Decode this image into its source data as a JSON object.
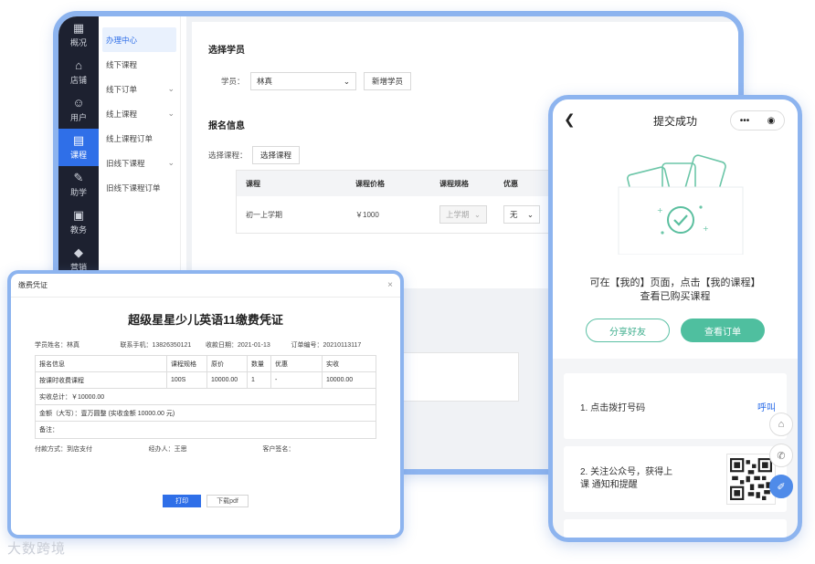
{
  "tablet": {
    "rail": [
      {
        "icon": "dashboard-icon",
        "glyph": "▦",
        "label": "概况"
      },
      {
        "icon": "store-icon",
        "glyph": "⌂",
        "label": "店铺"
      },
      {
        "icon": "user-icon",
        "glyph": "☺",
        "label": "用户"
      },
      {
        "icon": "course-icon",
        "glyph": "▤",
        "label": "课程"
      },
      {
        "icon": "tutor-icon",
        "glyph": "✎",
        "label": "助学"
      },
      {
        "icon": "teaching-icon",
        "glyph": "▣",
        "label": "教务"
      },
      {
        "icon": "marketing-icon",
        "glyph": "◆",
        "label": "营销"
      }
    ],
    "submenu": [
      {
        "label": "办理中心",
        "expandable": false
      },
      {
        "label": "线下课程",
        "expandable": false
      },
      {
        "label": "线下订单",
        "expandable": true
      },
      {
        "label": "线上课程",
        "expandable": true
      },
      {
        "label": "线上课程订单",
        "expandable": false
      },
      {
        "label": "旧线下课程",
        "expandable": true
      },
      {
        "label": "旧线下课程订单",
        "expandable": false
      }
    ],
    "select_student": {
      "title": "选择学员",
      "label": "学员：",
      "value": "林真",
      "add_button": "新增学员"
    },
    "signup": {
      "title": "报名信息",
      "label": "选择课程：",
      "choose_button": "选择课程",
      "headers": [
        "课程",
        "课程价格",
        "课程规格",
        "优惠"
      ],
      "row": {
        "course": "初一上学期",
        "price": "￥1000",
        "spec": "上学期",
        "discount": "无"
      }
    }
  },
  "receipt": {
    "window_title": "缴费凭证",
    "title": "超级星星少儿英语11缴费凭证",
    "meta": [
      "学员姓名：林真",
      "联系手机：13826350121",
      "收款日期：2021-01-13",
      "订单编号：20210113117"
    ],
    "headers": [
      "报名信息",
      "课程规格",
      "原价",
      "数量",
      "优惠",
      "实收"
    ],
    "row": [
      "按课时收费课程",
      "100S",
      "10000.00",
      "1",
      "-",
      "10000.00"
    ],
    "total": "实收总计：￥10000.00",
    "amount_words": "金额（大写）：壹万圆整 (实收金额 10000.00 元)",
    "remark": "备注：",
    "footer": [
      "付款方式：到店支付",
      "经办人：王思",
      "客户签名："
    ],
    "print_button": "打印",
    "download_button": "下载pdf"
  },
  "phone": {
    "title": "提交成功",
    "message_line1": "可在【我的】页面，点击【我的课程】",
    "message_line2": "查看已购买课程",
    "share_button": "分享好友",
    "view_order_button": "查看订单",
    "step1": "1. 点击拨打号码",
    "call_link": "呼叫",
    "step2_line1": "2. 关注公众号，获得上",
    "step2_line2": "课 通知和提醒"
  },
  "watermark": "大数跨境",
  "colors": {
    "primary": "#2f6fe8",
    "green": "#4fbf9f",
    "frame": "#8db4ef"
  }
}
